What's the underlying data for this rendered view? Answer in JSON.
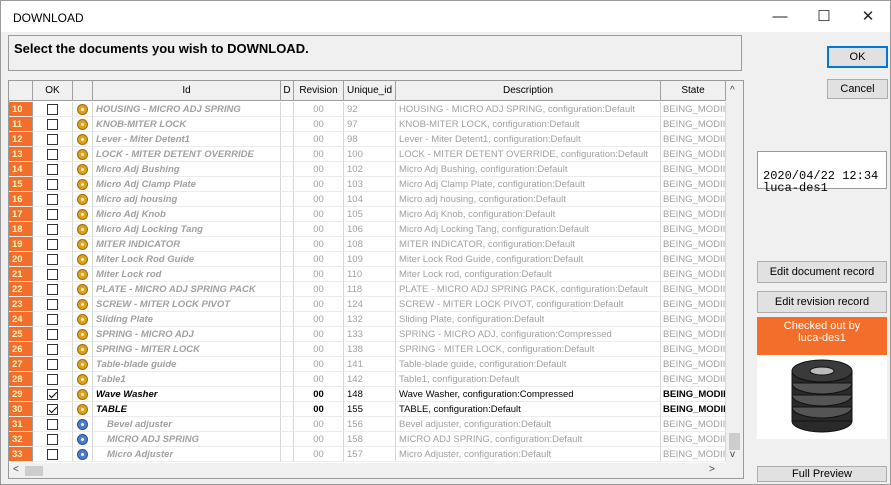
{
  "window": {
    "title": "DOWNLOAD",
    "minimize": "—",
    "maximize": "☐",
    "close": "✕"
  },
  "instruction": "Select the documents you wish to DOWNLOAD.",
  "columns": [
    "",
    "OK",
    "",
    "Id",
    "D",
    "Revision",
    "Unique_id",
    "Description",
    "State"
  ],
  "rows": [
    {
      "n": "10",
      "ok": false,
      "icon": "part-icon",
      "id": "HOUSING - MICRO ADJ SPRING",
      "d": "",
      "rev": "00",
      "uid": "92",
      "desc": "HOUSING - MICRO ADJ SPRING, configuration:Default",
      "state": "BEING_MODII",
      "bold": false,
      "sub": false
    },
    {
      "n": "11",
      "ok": false,
      "icon": "part-icon",
      "id": "KNOB-MITER LOCK",
      "d": "",
      "rev": "00",
      "uid": "97",
      "desc": "KNOB-MITER LOCK, configuration:Default",
      "state": "BEING_MODII",
      "bold": false,
      "sub": false
    },
    {
      "n": "12",
      "ok": false,
      "icon": "part-icon",
      "id": "Lever - Miter Detent1",
      "d": "",
      "rev": "00",
      "uid": "98",
      "desc": "Lever - Miter Detent1, configuration:Default",
      "state": "BEING_MODII",
      "bold": false,
      "sub": false
    },
    {
      "n": "13",
      "ok": false,
      "icon": "part-icon",
      "id": "LOCK - MITER DETENT OVERRIDE",
      "d": "",
      "rev": "00",
      "uid": "100",
      "desc": "LOCK - MITER DETENT OVERRIDE, configuration:Default",
      "state": "BEING_MODII",
      "bold": false,
      "sub": false
    },
    {
      "n": "14",
      "ok": false,
      "icon": "part-icon",
      "id": "Micro Adj Bushing",
      "d": "",
      "rev": "00",
      "uid": "102",
      "desc": "Micro Adj Bushing, configuration:Default",
      "state": "BEING_MODII",
      "bold": false,
      "sub": false
    },
    {
      "n": "15",
      "ok": false,
      "icon": "part-icon",
      "id": "Micro Adj Clamp Plate",
      "d": "",
      "rev": "00",
      "uid": "103",
      "desc": "Micro Adj Clamp Plate, configuration:Default",
      "state": "BEING_MODII",
      "bold": false,
      "sub": false
    },
    {
      "n": "16",
      "ok": false,
      "icon": "part-icon",
      "id": "Micro adj housing",
      "d": "",
      "rev": "00",
      "uid": "104",
      "desc": "Micro adj housing, configuration:Default",
      "state": "BEING_MODII",
      "bold": false,
      "sub": false
    },
    {
      "n": "17",
      "ok": false,
      "icon": "part-icon",
      "id": "Micro Adj Knob",
      "d": "",
      "rev": "00",
      "uid": "105",
      "desc": "Micro Adj Knob, configuration:Default",
      "state": "BEING_MODII",
      "bold": false,
      "sub": false
    },
    {
      "n": "18",
      "ok": false,
      "icon": "part-icon",
      "id": "Micro Adj Locking Tang",
      "d": "",
      "rev": "00",
      "uid": "106",
      "desc": "Micro Adj Locking Tang, configuration:Default",
      "state": "BEING_MODII",
      "bold": false,
      "sub": false
    },
    {
      "n": "19",
      "ok": false,
      "icon": "part-icon",
      "id": "MITER INDICATOR",
      "d": "",
      "rev": "00",
      "uid": "108",
      "desc": "MITER INDICATOR, configuration:Default",
      "state": "BEING_MODII",
      "bold": false,
      "sub": false
    },
    {
      "n": "20",
      "ok": false,
      "icon": "part-icon",
      "id": "Miter Lock Rod Guide",
      "d": "",
      "rev": "00",
      "uid": "109",
      "desc": "Miter Lock Rod Guide, configuration:Default",
      "state": "BEING_MODII",
      "bold": false,
      "sub": false
    },
    {
      "n": "21",
      "ok": false,
      "icon": "part-icon",
      "id": "Miter Lock rod",
      "d": "",
      "rev": "00",
      "uid": "110",
      "desc": "Miter Lock rod, configuration:Default",
      "state": "BEING_MODII",
      "bold": false,
      "sub": false
    },
    {
      "n": "22",
      "ok": false,
      "icon": "part-icon",
      "id": "PLATE - MICRO ADJ SPRING PACK",
      "d": "",
      "rev": "00",
      "uid": "118",
      "desc": "PLATE - MICRO ADJ SPRING PACK, configuration:Default",
      "state": "BEING_MODII",
      "bold": false,
      "sub": false
    },
    {
      "n": "23",
      "ok": false,
      "icon": "part-icon",
      "id": "SCREW - MITER LOCK PIVOT",
      "d": "",
      "rev": "00",
      "uid": "124",
      "desc": "SCREW - MITER LOCK PIVOT, configuration:Default",
      "state": "BEING_MODII",
      "bold": false,
      "sub": false
    },
    {
      "n": "24",
      "ok": false,
      "icon": "part-icon",
      "id": "Sliding Plate",
      "d": "",
      "rev": "00",
      "uid": "132",
      "desc": "Sliding Plate, configuration:Default",
      "state": "BEING_MODII",
      "bold": false,
      "sub": false
    },
    {
      "n": "25",
      "ok": false,
      "icon": "part-icon",
      "id": "SPRING -  MICRO ADJ",
      "d": "",
      "rev": "00",
      "uid": "133",
      "desc": "SPRING -  MICRO ADJ, configuration:Compressed",
      "state": "BEING_MODII",
      "bold": false,
      "sub": false
    },
    {
      "n": "26",
      "ok": false,
      "icon": "part-icon",
      "id": "SPRING - MITER LOCK",
      "d": "",
      "rev": "00",
      "uid": "138",
      "desc": "SPRING - MITER LOCK, configuration:Default",
      "state": "BEING_MODII",
      "bold": false,
      "sub": false
    },
    {
      "n": "27",
      "ok": false,
      "icon": "part-icon",
      "id": "Table-blade guide",
      "d": "",
      "rev": "00",
      "uid": "141",
      "desc": "Table-blade guide, configuration:Default",
      "state": "BEING_MODII",
      "bold": false,
      "sub": false
    },
    {
      "n": "28",
      "ok": false,
      "icon": "part-icon",
      "id": "Table1",
      "d": "",
      "rev": "00",
      "uid": "142",
      "desc": "Table1, configuration:Default",
      "state": "BEING_MODII",
      "bold": false,
      "sub": false
    },
    {
      "n": "29",
      "ok": true,
      "icon": "part-icon",
      "id": "Wave Washer",
      "d": "",
      "rev": "00",
      "uid": "148",
      "desc": "Wave Washer, configuration:Compressed",
      "state": "BEING_MODII",
      "bold": true,
      "sub": false
    },
    {
      "n": "30",
      "ok": true,
      "icon": "part-icon",
      "id": "TABLE",
      "d": "",
      "rev": "00",
      "uid": "155",
      "desc": "TABLE, configuration:Default",
      "state": "BEING_MODII",
      "bold": true,
      "sub": false
    },
    {
      "n": "31",
      "ok": false,
      "icon": "assembly-icon",
      "id": "Bevel adjuster",
      "d": "",
      "rev": "00",
      "uid": "156",
      "desc": "Bevel adjuster, configuration:Default",
      "state": "BEING_MODII",
      "bold": false,
      "sub": true
    },
    {
      "n": "32",
      "ok": false,
      "icon": "assembly-icon",
      "id": "MICRO ADJ SPRING",
      "d": "",
      "rev": "00",
      "uid": "158",
      "desc": "MICRO ADJ SPRING, configuration:Default",
      "state": "BEING_MODII",
      "bold": false,
      "sub": true
    },
    {
      "n": "33",
      "ok": false,
      "icon": "assembly-icon",
      "id": "Micro Adjuster",
      "d": "",
      "rev": "00",
      "uid": "157",
      "desc": "Micro Adjuster, configuration:Default",
      "state": "BEING_MODII",
      "bold": false,
      "sub": true
    }
  ],
  "buttons": {
    "ok": "OK",
    "cancel": "Cancel",
    "edit_document": "Edit document record",
    "edit_revision": "Edit revision record",
    "full_preview": "Full Preview"
  },
  "info": {
    "datetime": "2020/04/22 12:34",
    "user": "luca-des1"
  },
  "checkout": {
    "line1": "Checked out by",
    "line2": "luca-des1"
  },
  "colors": {
    "row_number_bg": "#f36e2a",
    "checkout_bg": "#f36e2a",
    "default_button_border": "#0078d7"
  }
}
